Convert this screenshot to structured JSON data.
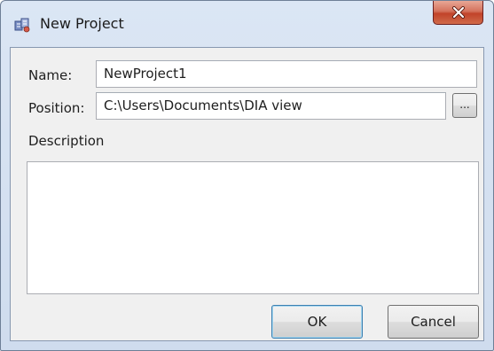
{
  "window": {
    "title": "New Project",
    "icon": "project-icon",
    "close_icon": "close-icon"
  },
  "form": {
    "name_label": "Name:",
    "name_value": "NewProject1",
    "position_label": "Position:",
    "position_value": "C:\\Users\\Documents\\DIA view",
    "browse_label": "...",
    "description_label": "Description",
    "description_value": ""
  },
  "buttons": {
    "ok_label": "OK",
    "cancel_label": "Cancel"
  },
  "colors": {
    "close_button": "#c1432a",
    "frame": "#cfdcee"
  }
}
